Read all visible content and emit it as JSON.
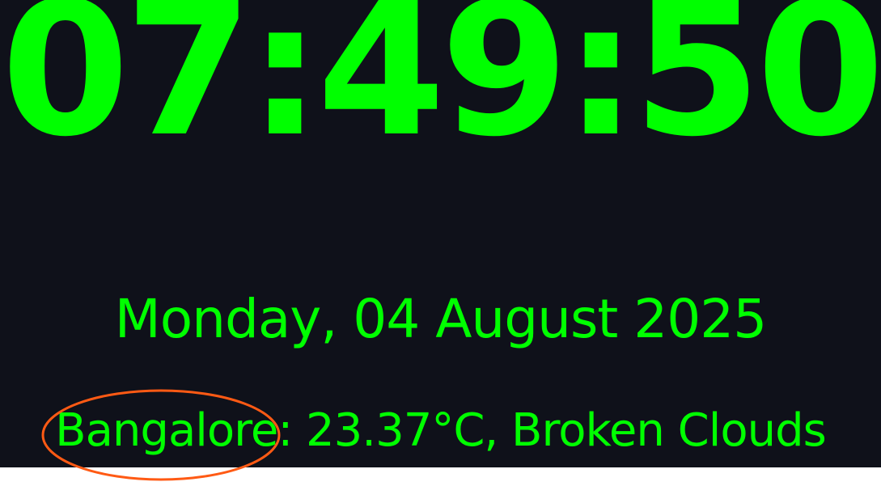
{
  "clock": {
    "time": "07:49:50"
  },
  "date": {
    "text": "Monday, 04 August 2025"
  },
  "weather": {
    "city": "Bangalore",
    "separator": ":",
    "details": " 23.37°C, Broken Clouds"
  },
  "colors": {
    "background": "#0f111a",
    "text": "#00ff00",
    "annotation": "#ff5a14",
    "bottom_strip": "#ffffff"
  }
}
